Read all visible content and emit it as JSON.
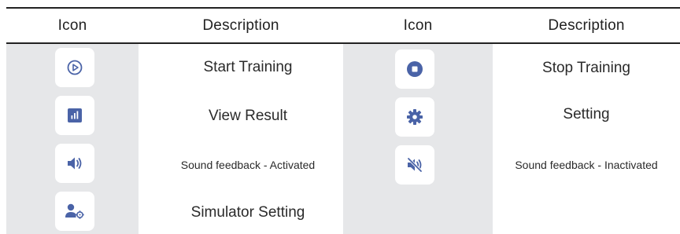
{
  "table": {
    "headers": {
      "left_icon": "Icon",
      "left_description": "Description",
      "right_icon": "Icon",
      "right_description": "Description"
    },
    "left_rows": [
      {
        "icon": "play-circle-icon",
        "description": "Start Training"
      },
      {
        "icon": "bar-chart-icon",
        "description": "View Result"
      },
      {
        "icon": "volume-up-icon",
        "description": "Sound feedback - Activated"
      },
      {
        "icon": "user-settings-icon",
        "description": "Simulator Setting"
      }
    ],
    "right_rows": [
      {
        "icon": "stop-circle-icon",
        "description": "Stop Training"
      },
      {
        "icon": "gear-icon",
        "description": "Setting"
      },
      {
        "icon": "volume-mute-icon",
        "description": "Sound feedback - Inactivated"
      }
    ]
  },
  "colors": {
    "accent": "#4a63a7",
    "icon_column_bg": "#e6e7e9",
    "rule": "#222222"
  }
}
